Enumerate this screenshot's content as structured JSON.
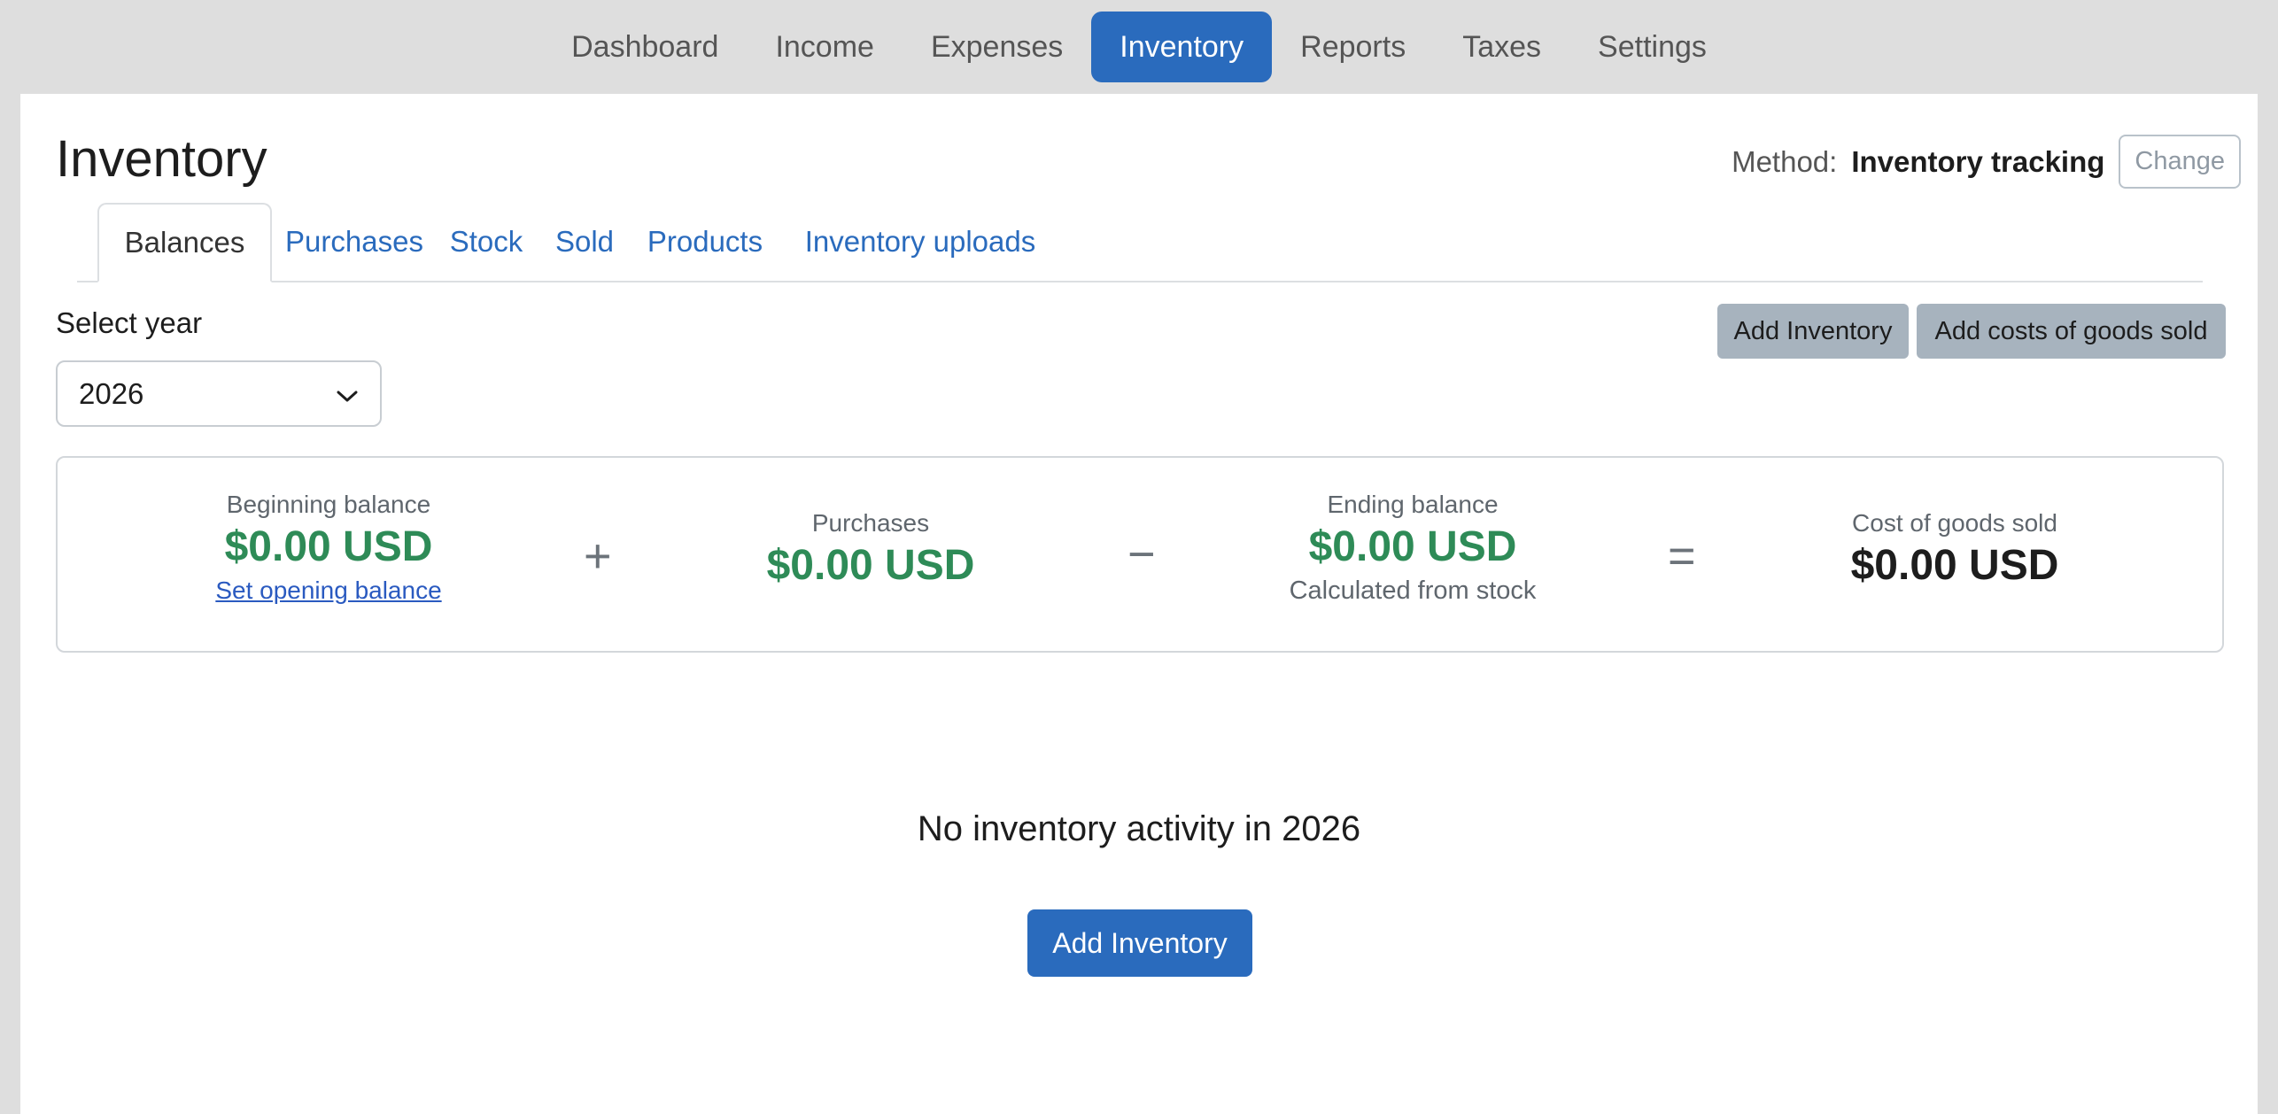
{
  "nav": {
    "items": [
      "Dashboard",
      "Income",
      "Expenses",
      "Inventory",
      "Reports",
      "Taxes",
      "Settings"
    ],
    "active": "Inventory"
  },
  "page": {
    "title": "Inventory",
    "method_label": "Method:",
    "method_value": "Inventory tracking",
    "change_label": "Change"
  },
  "tabs": [
    "Balances",
    "Purchases",
    "Stock",
    "Sold",
    "Products",
    "Inventory uploads"
  ],
  "year": {
    "label": "Select year",
    "selected": "2026"
  },
  "actions": {
    "add_inventory": "Add Inventory",
    "add_cogs": "Add costs of goods sold"
  },
  "summary": {
    "beginning": {
      "caption": "Beginning balance",
      "amount": "$0.00 USD",
      "link": "Set opening balance"
    },
    "purchases": {
      "caption": "Purchases",
      "amount": "$0.00 USD"
    },
    "ending": {
      "caption": "Ending balance",
      "amount": "$0.00 USD",
      "note": "Calculated from stock"
    },
    "cogs": {
      "caption": "Cost of goods sold",
      "amount": "$0.00 USD"
    },
    "op_plus": "+",
    "op_minus": "−",
    "op_equals": "="
  },
  "empty": {
    "message": "No inventory activity in 2026",
    "button": "Add Inventory"
  },
  "colors": {
    "primary": "#2a6bbd",
    "positive": "#2e8b57",
    "secondary_button": "#a7b3be"
  }
}
